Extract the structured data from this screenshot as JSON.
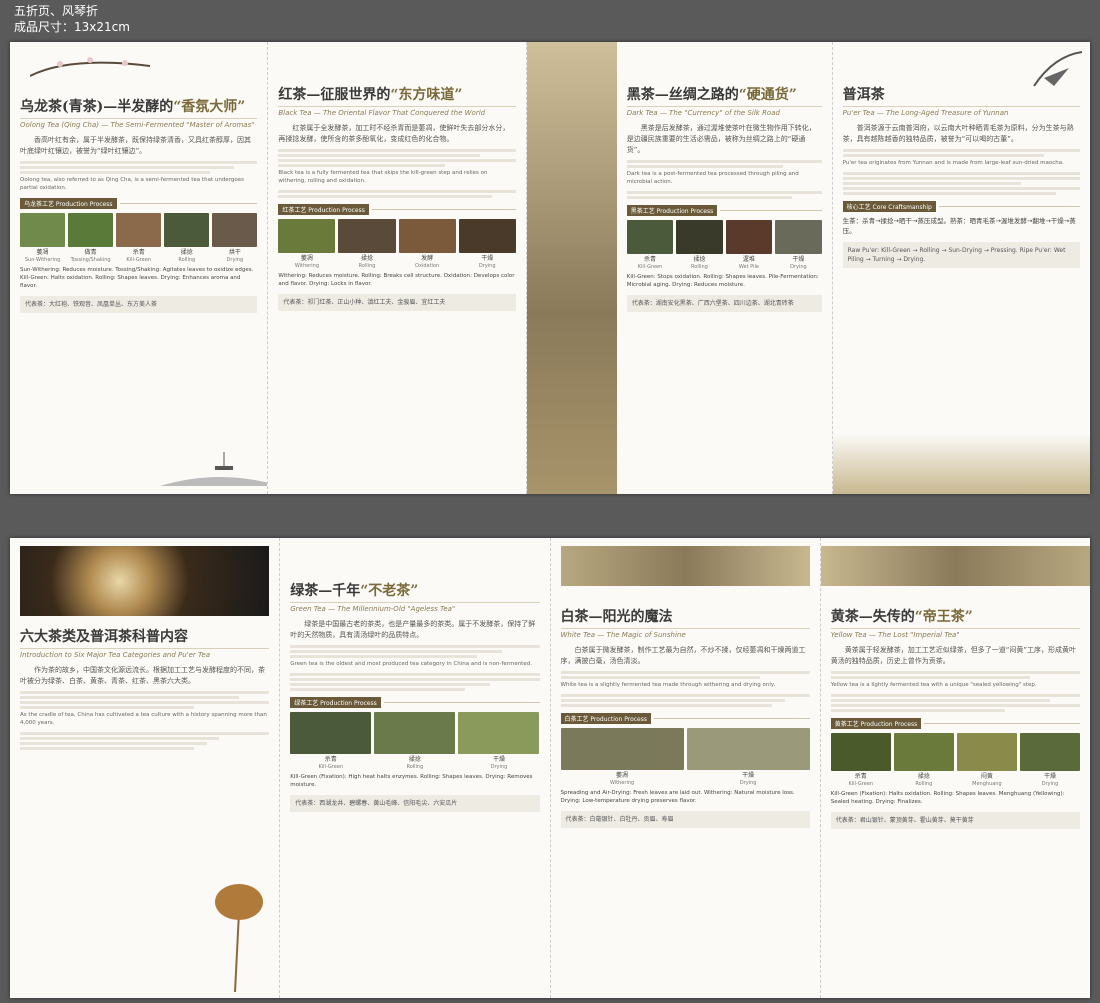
{
  "header": {
    "line1": "五折页、风琴折",
    "line2": "成品尺寸：13x21cm"
  },
  "row1": {
    "p1": {
      "title_pre": "乌龙茶(青茶)—半发酵的",
      "title_q": "“香氛大师”",
      "subtitle": "Oolong Tea (Qing Cha) — The Semi-Fermented \"Master of Aromas\"",
      "zh": "香高叶红有余，属于半发酵茶，既保持绿茶清香，又具红茶醇厚，因其叶底绿叶红镶边，被誉为“绿叶红镶边”。",
      "en": "Oolong tea, also referred to as Qing Cha, is a semi-fermented tea that undergoes partial oxidation.",
      "sec": "乌龙茶工艺 Production Process",
      "steps": [
        {
          "zh": "萎凋",
          "en": "Sun-Withering"
        },
        {
          "zh": "做青",
          "en": "Tossing/Shaking"
        },
        {
          "zh": "杀青",
          "en": "Kill-Green"
        },
        {
          "zh": "揉捻",
          "en": "Rolling"
        },
        {
          "zh": "烘干",
          "en": "Drying"
        }
      ],
      "bullets": "Sun-Withering: Reduces moisture. Tossing/Shaking: Agitates leaves to oxidize edges. Kill-Green: Halts oxidation. Rolling: Shapes leaves. Drying: Enhances aroma and flavor.",
      "rep": "代表茶：大红袍、铁观音、凤凰单丛、东方美人茶"
    },
    "p2": {
      "title_pre": "红茶—征服世界的",
      "title_q": "“东方味道”",
      "subtitle": "Black Tea — The Oriental Flavor That Conquered the World",
      "zh": "红茶属于全发酵茶，加工时不经杀青而是萎凋，使鲜叶失去部分水分，再揉捻发酵，使所含的茶多酚氧化，变成红色的化合物。",
      "en": "Black tea is a fully fermented tea that skips the kill-green step and relies on withering, rolling and oxidation.",
      "sec": "红茶工艺 Production Process",
      "steps": [
        {
          "zh": "萎凋",
          "en": "Withering"
        },
        {
          "zh": "揉捻",
          "en": "Rolling"
        },
        {
          "zh": "发酵",
          "en": "Oxidation"
        },
        {
          "zh": "干燥",
          "en": "Drying"
        }
      ],
      "bullets": "Withering: Reduces moisture. Rolling: Breaks cell structure. Oxidation: Develops color and flavor. Drying: Locks in flavor.",
      "rep": "代表茶：祁门红茶、正山小种、滇红工夫、金骏眉、宜红工夫"
    },
    "p3": {
      "title_pre": "黑茶—丝绸之路的",
      "title_q": "“硬通货”",
      "subtitle": "Dark Tea — The \"Currency\" of the Silk Road",
      "zh": "黑茶是后发酵茶，通过渥堆使茶叶在微生物作用下转化，是边疆民族重要的生活必需品，被称为丝绸之路上的“硬通货”。",
      "en": "Dark tea is a post-fermented tea processed through piling and microbial action.",
      "sec": "黑茶工艺 Production Process",
      "steps": [
        {
          "zh": "杀青",
          "en": "Kill-Green"
        },
        {
          "zh": "揉捻",
          "en": "Rolling"
        },
        {
          "zh": "渥堆",
          "en": "Wet Pile"
        },
        {
          "zh": "干燥",
          "en": "Drying"
        }
      ],
      "bullets": "Kill-Green: Stops oxidation. Rolling: Shapes leaves. Pile-Fermentation: Microbial aging. Drying: Reduces moisture.",
      "rep": "代表茶：湖南安化黑茶、广西六堡茶、四川边茶、湖北青砖茶"
    },
    "p4": {
      "title_pre": "普洱茶",
      "title_q": "",
      "subtitle": "Pu'er Tea — The Long-Aged Treasure of Yunnan",
      "zh": "普洱茶源于云南普洱府，以云南大叶种晒青毛茶为原料，分为生茶与熟茶，具有越陈越香的独特品质，被誉为“可以喝的古董”。",
      "en": "Pu'er tea originates from Yunnan and is made from large-leaf sun-dried maocha.",
      "sec": "核心工艺 Core Craftsmanship",
      "steps": [],
      "bullets": "生茶：杀青→揉捻→晒干→蒸压成型。熟茶：晒青毛茶→渥堆发酵→翻堆→干燥→蒸压。",
      "rep": "Raw Pu'er: Kill-Green → Rolling → Sun-Drying → Pressing. Ripe Pu'er: Wet Piling → Turning → Drying."
    }
  },
  "row2": {
    "p1": {
      "title_pre": "六大茶类及普洱茶科普内容",
      "title_q": "",
      "subtitle": "Introduction to Six Major Tea Categories and Pu'er Tea",
      "zh": "作为茶的故乡，中国茶文化源远流长。根据加工工艺与发酵程度的不同，茶叶被分为绿茶、白茶、黄茶、青茶、红茶、黑茶六大类。",
      "en": "As the cradle of tea, China has cultivated a tea culture with a history spanning more than 4,000 years."
    },
    "p2": {
      "title_pre": "绿茶—千年",
      "title_q": "“不老茶”",
      "subtitle": "Green Tea — The Millennium-Old \"Ageless Tea\"",
      "zh": "绿茶是中国最古老的茶类，也是产量最多的茶类。属于不发酵茶，保持了鲜叶的天然物质，具有清汤绿叶的品质特点。",
      "en": "Green tea is the oldest and most produced tea category in China and is non-fermented.",
      "sec": "绿茶工艺 Production Process",
      "steps": [
        {
          "zh": "杀青",
          "en": "Kill-Green"
        },
        {
          "zh": "揉捻",
          "en": "Rolling"
        },
        {
          "zh": "干燥",
          "en": "Drying"
        }
      ],
      "bullets": "Kill-Green (Fixation): High heat halts enzymes. Rolling: Shapes leaves. Drying: Removes moisture.",
      "rep": "代表茶：西湖龙井、碧螺春、黄山毛峰、信阳毛尖、六安瓜片"
    },
    "p3": {
      "title_pre": "白茶—阳光的魔法",
      "title_q": "",
      "subtitle": "White Tea — The Magic of Sunshine",
      "zh": "白茶属于微发酵茶，制作工艺最为自然，不炒不揉，仅经萎凋和干燥两道工序，满披白毫，汤色清淡。",
      "en": "White tea is a slightly fermented tea made through withering and drying only.",
      "sec": "白茶工艺 Production Process",
      "steps": [
        {
          "zh": "萎凋",
          "en": "Withering"
        },
        {
          "zh": "干燥",
          "en": "Drying"
        }
      ],
      "bullets": "Spreading and Air-Drying: Fresh leaves are laid out. Withering: Natural moisture loss. Drying: Low-temperature drying preserves flavor.",
      "rep": "代表茶：白毫银针、白牡丹、贡眉、寿眉"
    },
    "p4": {
      "title_pre": "黄茶—失传的",
      "title_q": "“帝王茶”",
      "subtitle": "Yellow Tea — The Lost \"Imperial Tea\"",
      "zh": "黄茶属于轻发酵茶，加工工艺近似绿茶，但多了一道“闷黄”工序，形成黄叶黄汤的独特品质，历史上曾作为贡茶。",
      "en": "Yellow tea is a lightly fermented tea with a unique \"sealed yellowing\" step.",
      "sec": "黄茶工艺 Production Process",
      "steps": [
        {
          "zh": "杀青",
          "en": "Kill-Green"
        },
        {
          "zh": "揉捻",
          "en": "Rolling"
        },
        {
          "zh": "闷黄",
          "en": "Menghuang"
        },
        {
          "zh": "干燥",
          "en": "Drying"
        }
      ],
      "bullets": "Kill-Green (Fixation): Halts oxidation. Rolling: Shapes leaves. Menghuang (Yellowing): Sealed heating. Drying: Finalizes.",
      "rep": "代表茶：君山银针、蒙顶黄芽、霍山黄芽、莫干黄芽"
    }
  }
}
